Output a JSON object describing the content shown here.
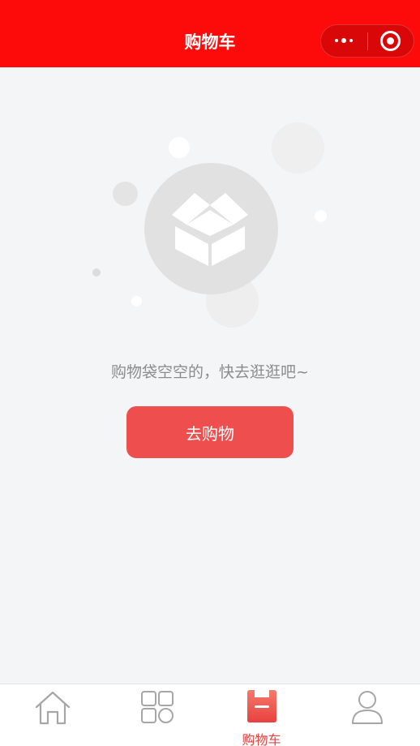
{
  "header": {
    "title": "购物车",
    "bg_color": "#fd0a0b",
    "capsule": {
      "more_icon": "more-dots-icon",
      "close_icon": "target-close-icon"
    }
  },
  "empty_state": {
    "illustration": "open-box-icon",
    "message": "购物袋空空的，快去逛逛吧~",
    "button_label": "去购物",
    "button_color": "#ef4e4e"
  },
  "tabbar": {
    "active_color": "#e8413f",
    "inactive_color": "#a6a6a6",
    "tabs": [
      {
        "icon": "home-icon",
        "label": "",
        "active": false
      },
      {
        "icon": "category-grid-icon",
        "label": "",
        "active": false
      },
      {
        "icon": "shopping-bag-icon",
        "label": "购物车",
        "active": true
      },
      {
        "icon": "user-icon",
        "label": "",
        "active": false
      }
    ]
  }
}
